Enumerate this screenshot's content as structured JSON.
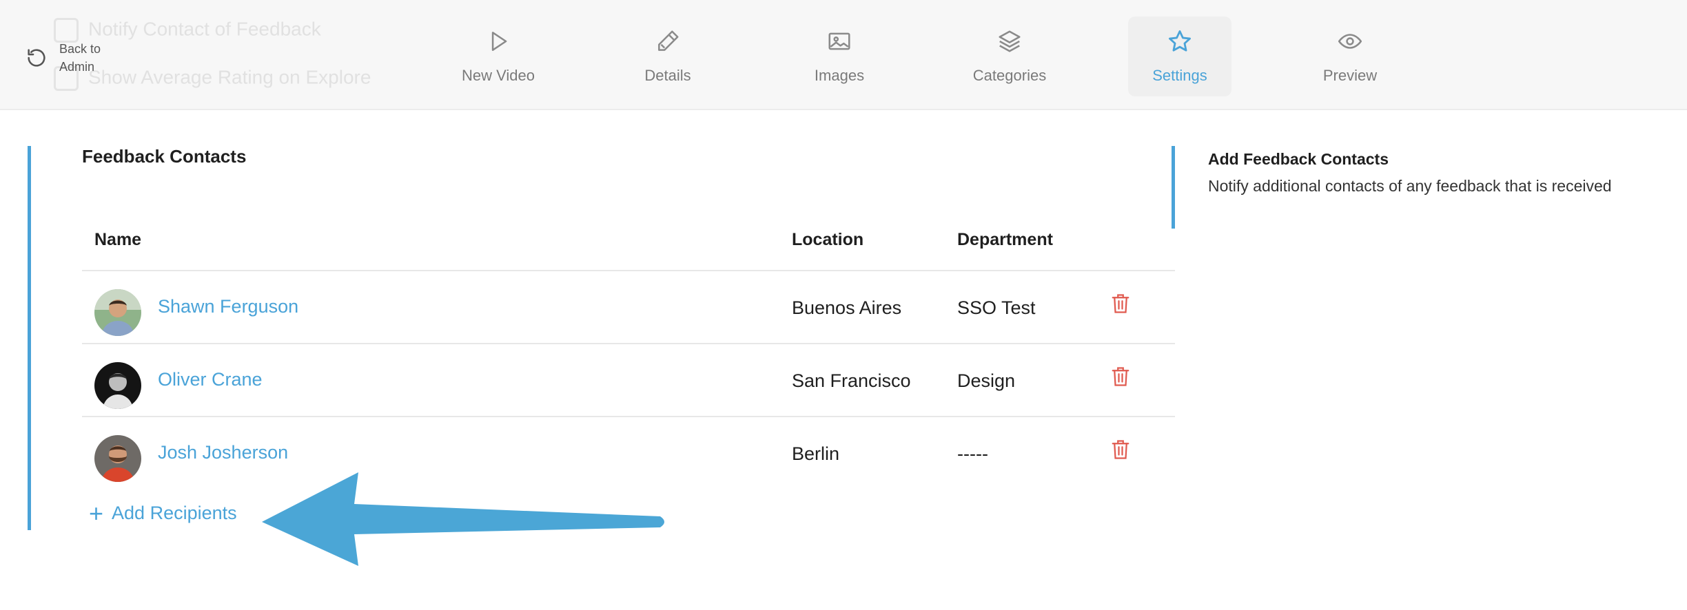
{
  "ghost_options": [
    {
      "label": "Notify Contact of Feedback"
    },
    {
      "label": "Show Average Rating on Explore"
    }
  ],
  "nav": {
    "back_label": "Back to Admin",
    "tabs": [
      {
        "label": "New Video",
        "icon": "play-icon"
      },
      {
        "label": "Details",
        "icon": "pencil-icon"
      },
      {
        "label": "Images",
        "icon": "image-icon"
      },
      {
        "label": "Categories",
        "icon": "layers-icon"
      },
      {
        "label": "Settings",
        "icon": "star-icon",
        "active": true
      },
      {
        "label": "Preview",
        "icon": "eye-icon"
      }
    ]
  },
  "feedback": {
    "title": "Feedback Contacts",
    "columns": {
      "name": "Name",
      "location": "Location",
      "department": "Department"
    },
    "rows": [
      {
        "name": "Shawn Ferguson",
        "location": "Buenos Aires",
        "department": "SSO Test"
      },
      {
        "name": "Oliver Crane",
        "location": "San Francisco",
        "department": "Design"
      },
      {
        "name": "Josh Josherson",
        "location": "Berlin",
        "department": "-----"
      }
    ],
    "add_label": "Add Recipients"
  },
  "help": {
    "title": "Add Feedback Contacts",
    "description": "Notify additional contacts of any feedback that is received"
  },
  "colors": {
    "accent": "#4aa3d8",
    "danger": "#e05a4f",
    "annotation_arrow": "#4ba6d6"
  }
}
